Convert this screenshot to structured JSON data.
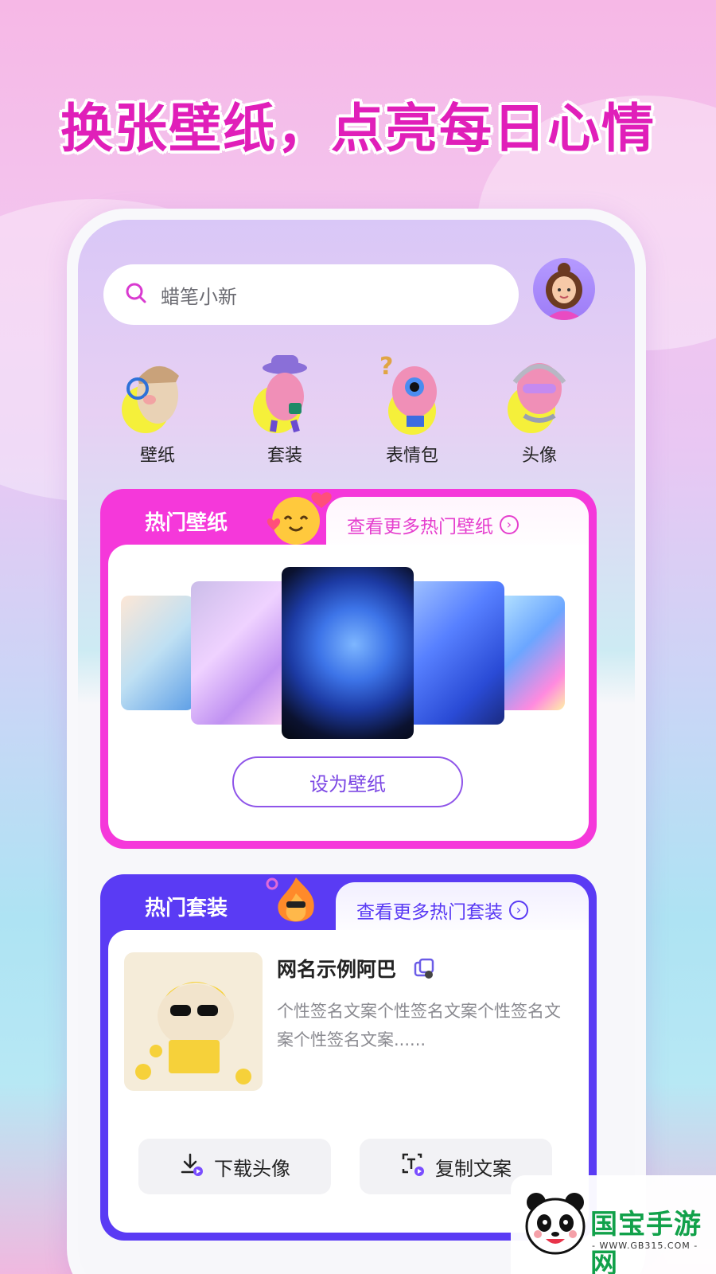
{
  "headline": "换张壁纸，点亮每日心情",
  "search": {
    "placeholder": "蜡笔小新"
  },
  "categories": [
    {
      "label": "壁纸"
    },
    {
      "label": "套装"
    },
    {
      "label": "表情包"
    },
    {
      "label": "头像"
    }
  ],
  "hot_wallpaper": {
    "title": "热门壁纸",
    "more": "查看更多热门壁纸",
    "set_button": "设为壁纸"
  },
  "hot_suit": {
    "title": "热门套装",
    "more": "查看更多热门套装",
    "nickname": "网名示例阿巴",
    "signature": "个性签名文案个性签名文案个性签名文案个性签名文案......",
    "download_button": "下载头像",
    "copy_button": "复制文案"
  },
  "watermark": {
    "name": "国宝手游网",
    "url": "- WWW.GB315.COM -"
  },
  "colors": {
    "headline": "#e01fb9",
    "hot_wallpaper_accent": "#f538da",
    "hot_suit_accent": "#5a3bf4",
    "button_purple": "#8f55e9"
  }
}
